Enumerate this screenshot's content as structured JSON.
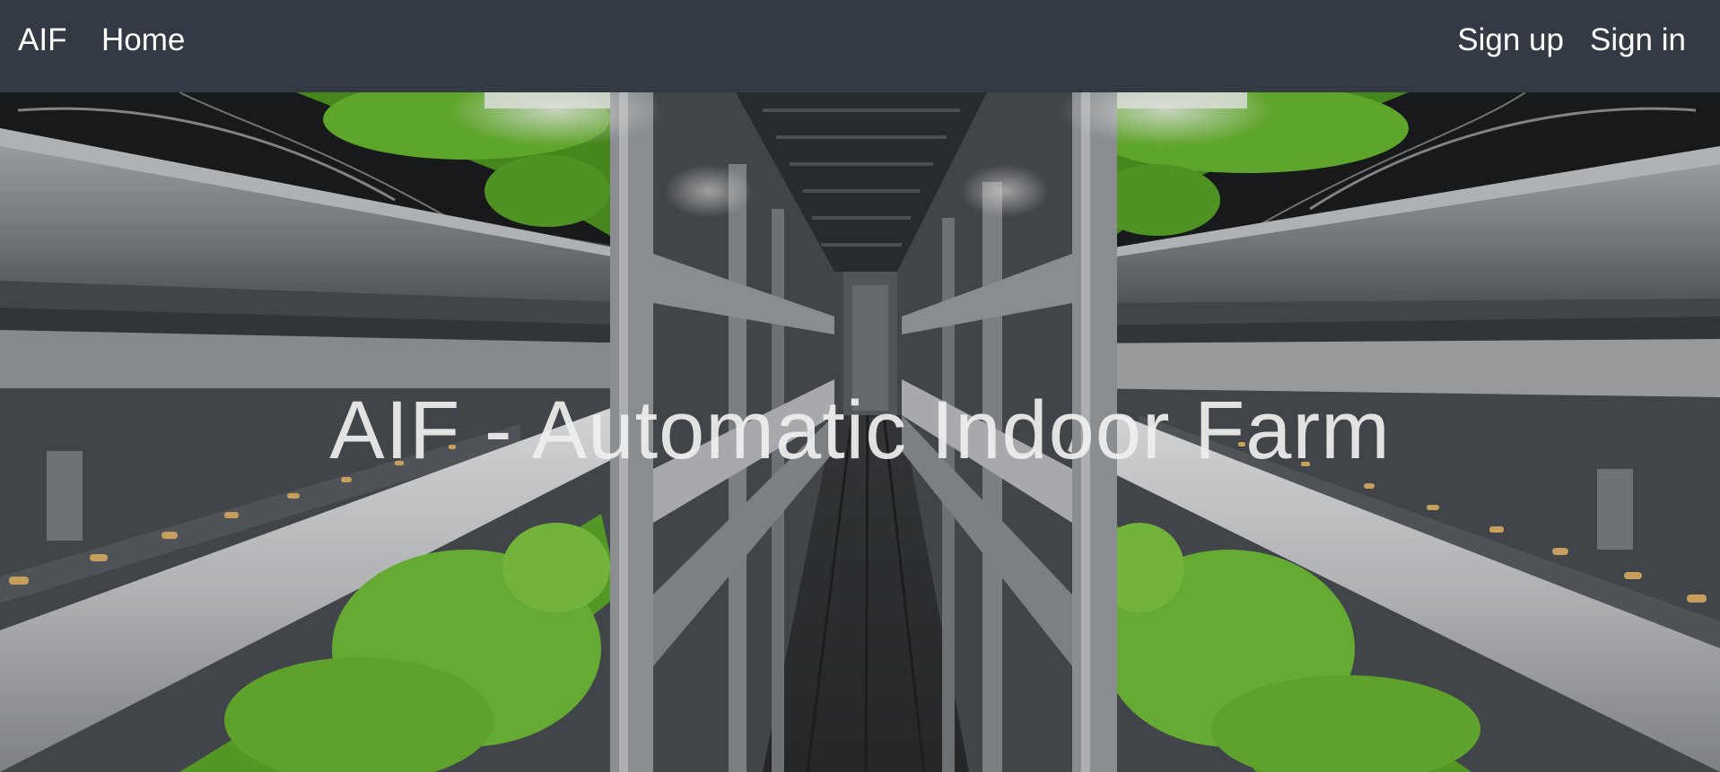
{
  "navbar": {
    "brand": "AIF",
    "home": "Home",
    "signup": "Sign up",
    "signin": "Sign in",
    "background": "#343a43"
  },
  "hero": {
    "title": "AIF - Automatic Indoor Farm",
    "image": "indoor-farm-photo",
    "colors": {
      "lettuce": "#5fae2a",
      "metal": "#9a9ea1",
      "pipe": "#d9dadc"
    }
  }
}
